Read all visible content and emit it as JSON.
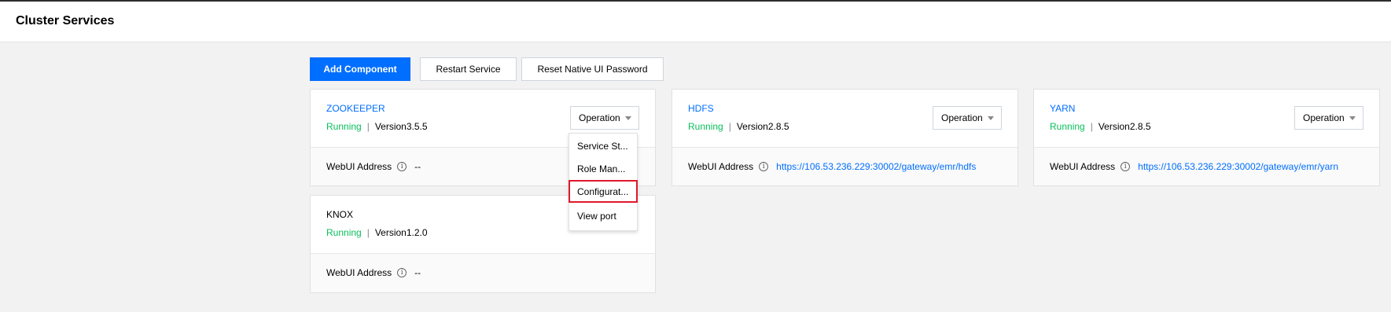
{
  "header": {
    "title": "Cluster Services"
  },
  "toolbar": {
    "add_component": "Add Component",
    "restart_service": "Restart Service",
    "reset_password": "Reset Native UI Password"
  },
  "services": [
    {
      "name": "ZOOKEEPER",
      "status": "Running",
      "version": "Version3.5.5",
      "operation": "Operation",
      "webui_label": "WebUI Address",
      "webui_value": "--"
    },
    {
      "name": "KNOX",
      "status": "Running",
      "version": "Version1.2.0",
      "webui_label": "WebUI Address",
      "webui_value": "--"
    },
    {
      "name": "HDFS",
      "status": "Running",
      "version": "Version2.8.5",
      "operation": "Operation",
      "webui_label": "WebUI Address",
      "webui_value": "https://106.53.236.229:30002/gateway/emr/hdfs"
    },
    {
      "name": "YARN",
      "status": "Running",
      "version": "Version2.8.5",
      "operation": "Operation",
      "webui_label": "WebUI Address",
      "webui_value": "https://106.53.236.229:30002/gateway/emr/yarn"
    }
  ],
  "separator": "|",
  "info_icon": "i",
  "dropdown": {
    "items": [
      "Service St...",
      "Role Man...",
      "Configurat...",
      "View port"
    ],
    "highlighted_index": 2
  },
  "colors": {
    "primary": "#006eff",
    "running": "#0abf5b",
    "highlight_border": "#e0182b"
  }
}
